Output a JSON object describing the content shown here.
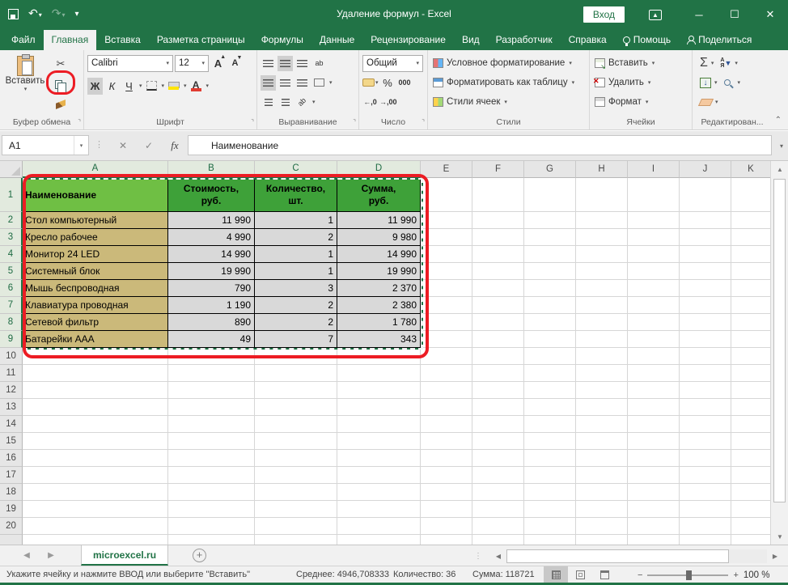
{
  "window": {
    "title": "Удаление формул - Excel",
    "sign_in": "Вход"
  },
  "menu_tabs": [
    {
      "label": "Файл",
      "selected": false,
      "icon": ""
    },
    {
      "label": "Главная",
      "selected": true,
      "icon": ""
    },
    {
      "label": "Вставка",
      "selected": false,
      "icon": ""
    },
    {
      "label": "Разметка страницы",
      "selected": false,
      "icon": ""
    },
    {
      "label": "Формулы",
      "selected": false,
      "icon": ""
    },
    {
      "label": "Данные",
      "selected": false,
      "icon": ""
    },
    {
      "label": "Рецензирование",
      "selected": false,
      "icon": ""
    },
    {
      "label": "Вид",
      "selected": false,
      "icon": ""
    },
    {
      "label": "Разработчик",
      "selected": false,
      "icon": ""
    },
    {
      "label": "Справка",
      "selected": false,
      "icon": ""
    },
    {
      "label": "Помощь",
      "selected": false,
      "icon": "lightbulb"
    },
    {
      "label": "Поделиться",
      "selected": false,
      "icon": "person"
    }
  ],
  "ribbon": {
    "clipboard": {
      "label": "Буфер обмена",
      "paste": "Вставить"
    },
    "font": {
      "label": "Шрифт",
      "family": "Calibri",
      "size": "12",
      "bold": "Ж",
      "italic": "К",
      "underline": "Ч"
    },
    "alignment": {
      "label": "Выравнивание"
    },
    "number": {
      "label": "Число",
      "format": "Общий",
      "percent": "%",
      "thousands": "000",
      "dec1": ",0",
      "dec2": ",00"
    },
    "styles": {
      "label": "Стили",
      "items": [
        "Условное форматирование",
        "Форматировать как таблицу",
        "Стили ячеек"
      ]
    },
    "cells": {
      "label": "Ячейки",
      "items": [
        "Вставить",
        "Удалить",
        "Формат"
      ]
    },
    "editing": {
      "label": "Редактирован..."
    }
  },
  "formula_bar": {
    "cell_ref": "A1",
    "fx": "fx",
    "formula": "Наименование"
  },
  "sheet": {
    "columns": [
      "A",
      "B",
      "C",
      "D",
      "E",
      "F",
      "G",
      "H",
      "I",
      "J",
      "K"
    ],
    "selected_columns": [
      "A",
      "B",
      "C",
      "D"
    ],
    "table": {
      "header": [
        "Наименование",
        "Стоимость,\nруб.",
        "Количество,\nшт.",
        "Сумма,\nруб."
      ],
      "rows": [
        [
          "Стол компьютерный",
          "11 990",
          "1",
          "11 990"
        ],
        [
          "Кресло рабочее",
          "4 990",
          "2",
          "9 980"
        ],
        [
          "Монитор 24 LED",
          "14 990",
          "1",
          "14 990"
        ],
        [
          "Системный блок",
          "19 990",
          "1",
          "19 990"
        ],
        [
          "Мышь беспроводная",
          "790",
          "3",
          "2 370"
        ],
        [
          "Клавиатура проводная",
          "1 190",
          "2",
          "2 380"
        ],
        [
          "Сетевой фильтр",
          "890",
          "2",
          "1 780"
        ],
        [
          "Батарейки AAA",
          "49",
          "7",
          "343"
        ]
      ]
    }
  },
  "sheet_tabs": {
    "active": "microexcel.ru"
  },
  "status_bar": {
    "hint": "Укажите ячейку и нажмите ВВОД или выберите \"Вставить\"",
    "average": "Среднее: 4946,708333",
    "count": "Количество: 36",
    "sum": "Сумма: 118721",
    "zoom_level": "100 %"
  }
}
